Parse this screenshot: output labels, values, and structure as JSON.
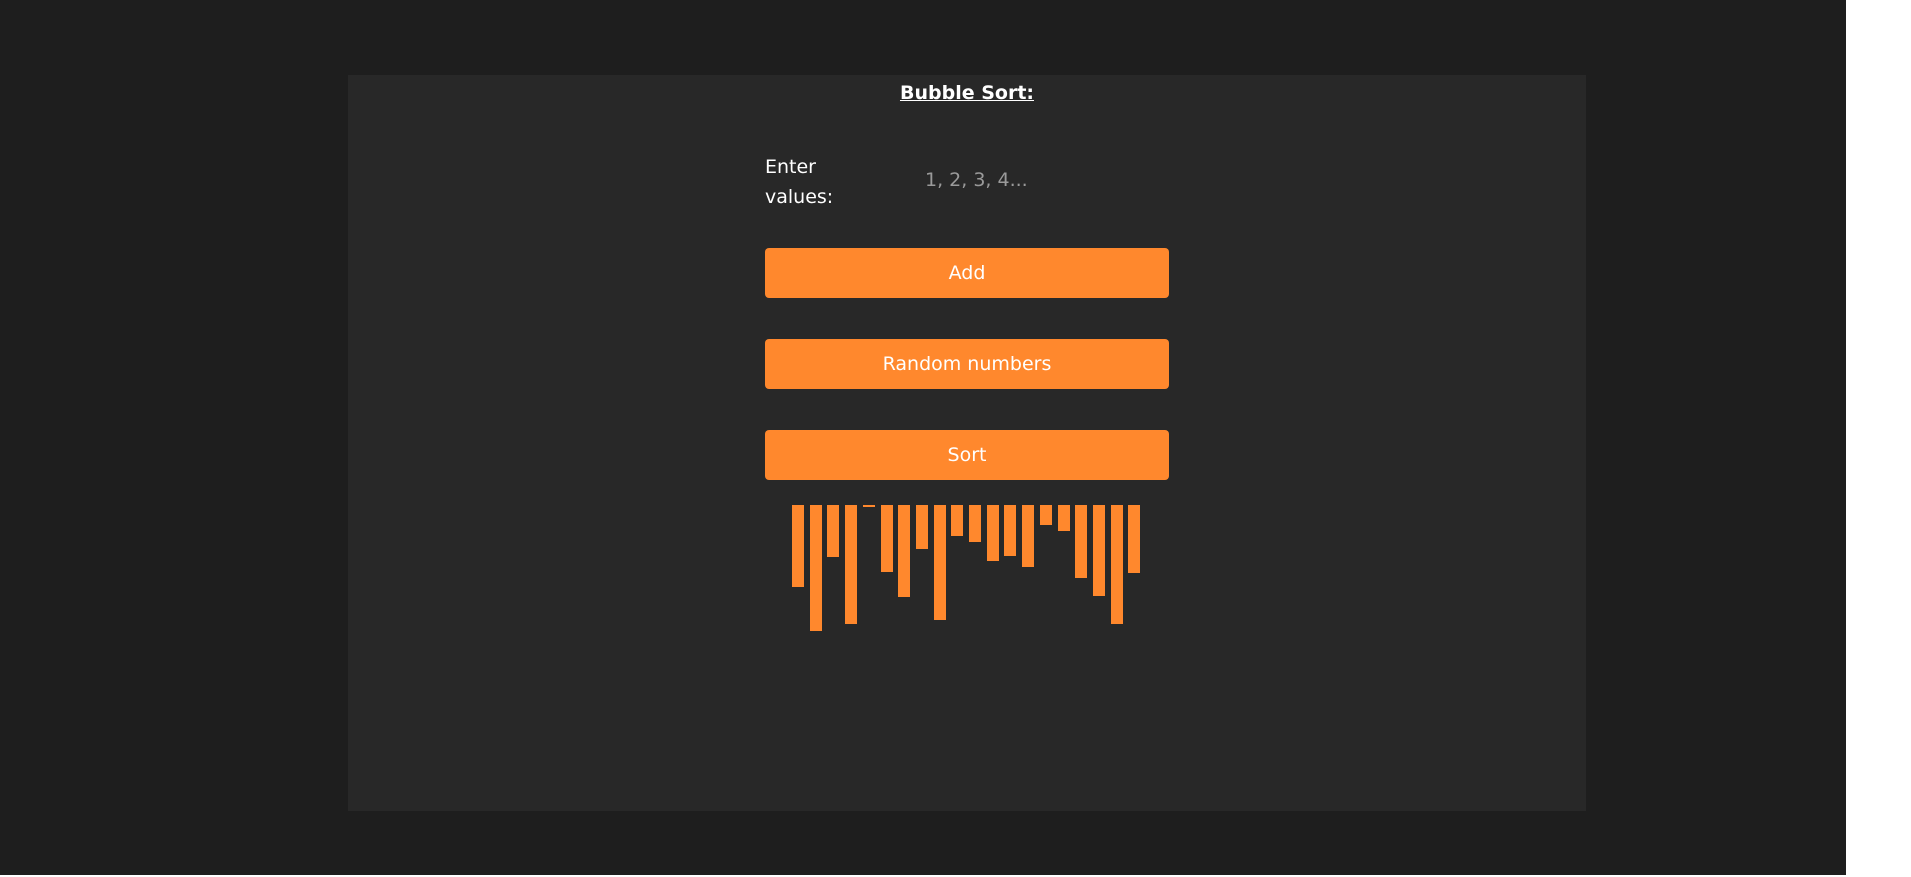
{
  "page": {
    "title": "Bubble Sort:"
  },
  "form": {
    "label": "Enter values:",
    "input_value": "",
    "input_placeholder": "1, 2, 3, 4...",
    "add_label": "Add",
    "random_label": "Random numbers",
    "sort_label": "Sort"
  },
  "colors": {
    "accent": "#ff882d",
    "background": "#1e1e1e",
    "panel": "#282828",
    "text": "#ffffff"
  },
  "bars": {
    "values": [
      82,
      126,
      52,
      119,
      2,
      67,
      92,
      44,
      115,
      31,
      37,
      56,
      51,
      62,
      20,
      26,
      73,
      91,
      119,
      68
    ],
    "max": 126
  }
}
